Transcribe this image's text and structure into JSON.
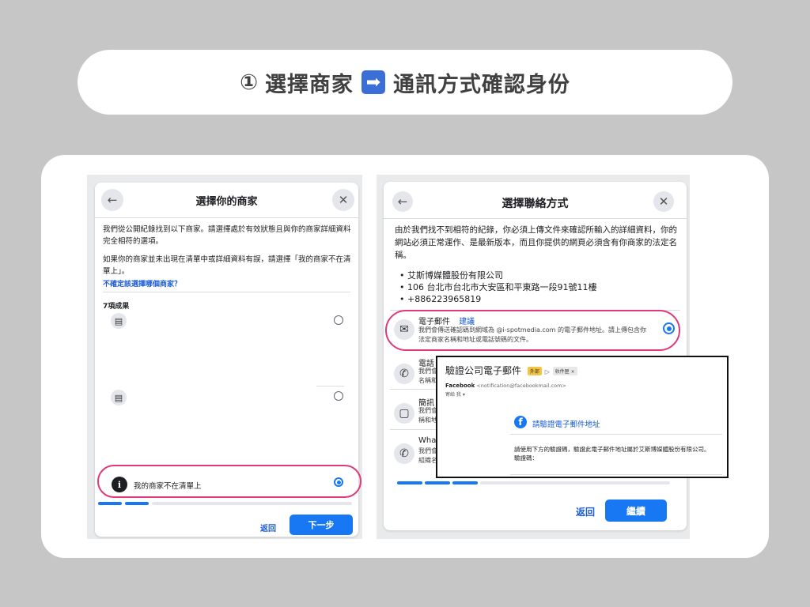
{
  "banner": {
    "step": "①",
    "left": "選擇商家",
    "arrow": "➡",
    "right": "通訊方式確認身份"
  },
  "left_modal": {
    "title": "選擇你的商家",
    "back_icon": "←",
    "close_icon": "✕",
    "intro": "我們從公開紀錄找到以下商家。請選擇處於有效狀態且與你的商家詳細資料完全相符的選項。",
    "intro2": "如果你的商家並未出現在清單中或詳細資料有誤，請選擇「我的商家不在清單上」。",
    "help_link": "不確定該選擇哪個商家？",
    "results_label": "7項成果",
    "not_listed": "我的商家不在清單上",
    "back_label": "返回",
    "next_label": "下一步",
    "progress_filled": 2,
    "progress_total": 10
  },
  "right_modal": {
    "title": "選擇聯絡方式",
    "back_icon": "←",
    "close_icon": "✕",
    "intro": "由於我們找不到相符的紀錄，你必須上傳文件來確認所輸入的詳細資料，你的網站必須正常運作、是最新版本，而且你提供的網頁必須含有你商家的法定名稱。",
    "details": [
      "艾斯博媒體股份有限公司",
      "106 台北市台北市大安區和平東路一段91號11樓",
      "+886223965819"
    ],
    "email_option": {
      "title": "電子郵件",
      "badge": "建議",
      "desc": "我們會傳送確認碼到網域為 @i-spotmedia.com 的電子郵件地址。請上傳包含你法定商家名稱和地址或電話號碼的文件。"
    },
    "phone_option": {
      "title": "電話",
      "desc1": "我們會",
      "desc2": "名稱和"
    },
    "sms_option": {
      "title": "簡訊",
      "desc1": "我們會",
      "desc2": "稱和地"
    },
    "whatsapp_option": {
      "title": "What",
      "desc1": "我們會",
      "desc2": "組織名"
    },
    "back_label": "返回",
    "continue_label": "繼續",
    "progress_filled": 3,
    "progress_total": 10
  },
  "email_popup": {
    "subject": "驗證公司電子郵件",
    "tag_external": "外部",
    "tag_inbox": "收件匣 ×",
    "sender_name": "Facebook",
    "sender_addr": "<notification@facebookmail.com>",
    "to_line": "寄給 我 ▾",
    "headline": "請驗證電子郵件地址",
    "body1": "請使用下方的驗證碼，驗證此電子郵件地址屬於艾斯博媒體股份有限公司。",
    "body2": "驗證碼："
  }
}
